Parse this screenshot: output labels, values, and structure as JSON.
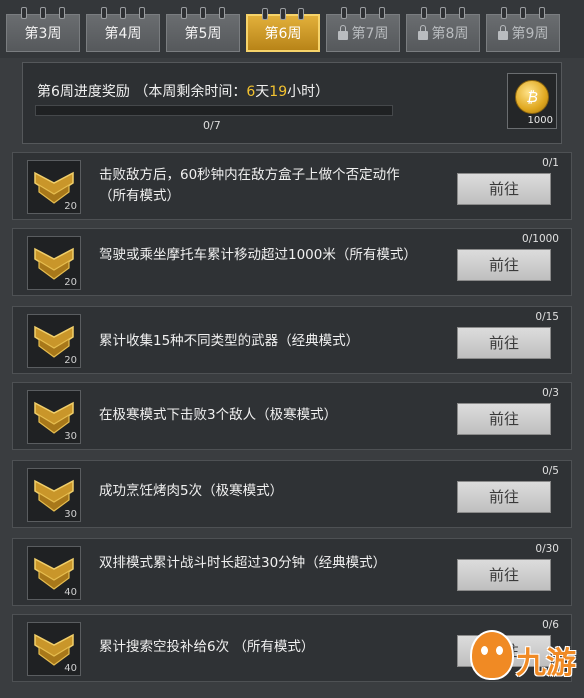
{
  "tabs": [
    {
      "label": "第3周",
      "state": "normal"
    },
    {
      "label": "第4周",
      "state": "normal"
    },
    {
      "label": "第5周",
      "state": "normal"
    },
    {
      "label": "第6周",
      "state": "active"
    },
    {
      "label": "第7周",
      "state": "locked"
    },
    {
      "label": "第8周",
      "state": "locked"
    },
    {
      "label": "第9周",
      "state": "locked"
    }
  ],
  "header": {
    "title_prefix": "第6周进度奖励 （本周剩余时间：",
    "days": "6",
    "day_unit": "天",
    "hours": "19",
    "hour_unit": "小时）",
    "progress_text": "0/7",
    "progress_fraction": 0,
    "reward_amount": "1000",
    "reward_icon": "coin-icon"
  },
  "tasks": [
    {
      "desc": "击败敌方后，60秒钟内在敌方盒子上做个否定动作（所有模式）",
      "count": "0/1",
      "level": "20",
      "button": "前往"
    },
    {
      "desc": "驾驶或乘坐摩托车累计移动超过1000米（所有模式）",
      "count": "0/1000",
      "level": "20",
      "button": "前往"
    },
    {
      "desc": "累计收集15种不同类型的武器（经典模式）",
      "count": "0/15",
      "level": "20",
      "button": "前往"
    },
    {
      "desc": "在极寒模式下击败3个敌人（极寒模式）",
      "count": "0/3",
      "level": "30",
      "button": "前往"
    },
    {
      "desc": "成功烹饪烤肉5次（极寒模式）",
      "count": "0/5",
      "level": "30",
      "button": "前往"
    },
    {
      "desc": "双排模式累计战斗时长超过30分钟（经典模式）",
      "count": "0/30",
      "level": "40",
      "button": "前往"
    },
    {
      "desc": "累计搜索空投补给6次 （所有模式）",
      "count": "0/6",
      "level": "40",
      "button": "前往"
    }
  ],
  "watermark": {
    "text": "九游"
  },
  "colors": {
    "accent": "#f3c230",
    "tab_active": "#d9a42e",
    "background": "#3a3d40"
  }
}
